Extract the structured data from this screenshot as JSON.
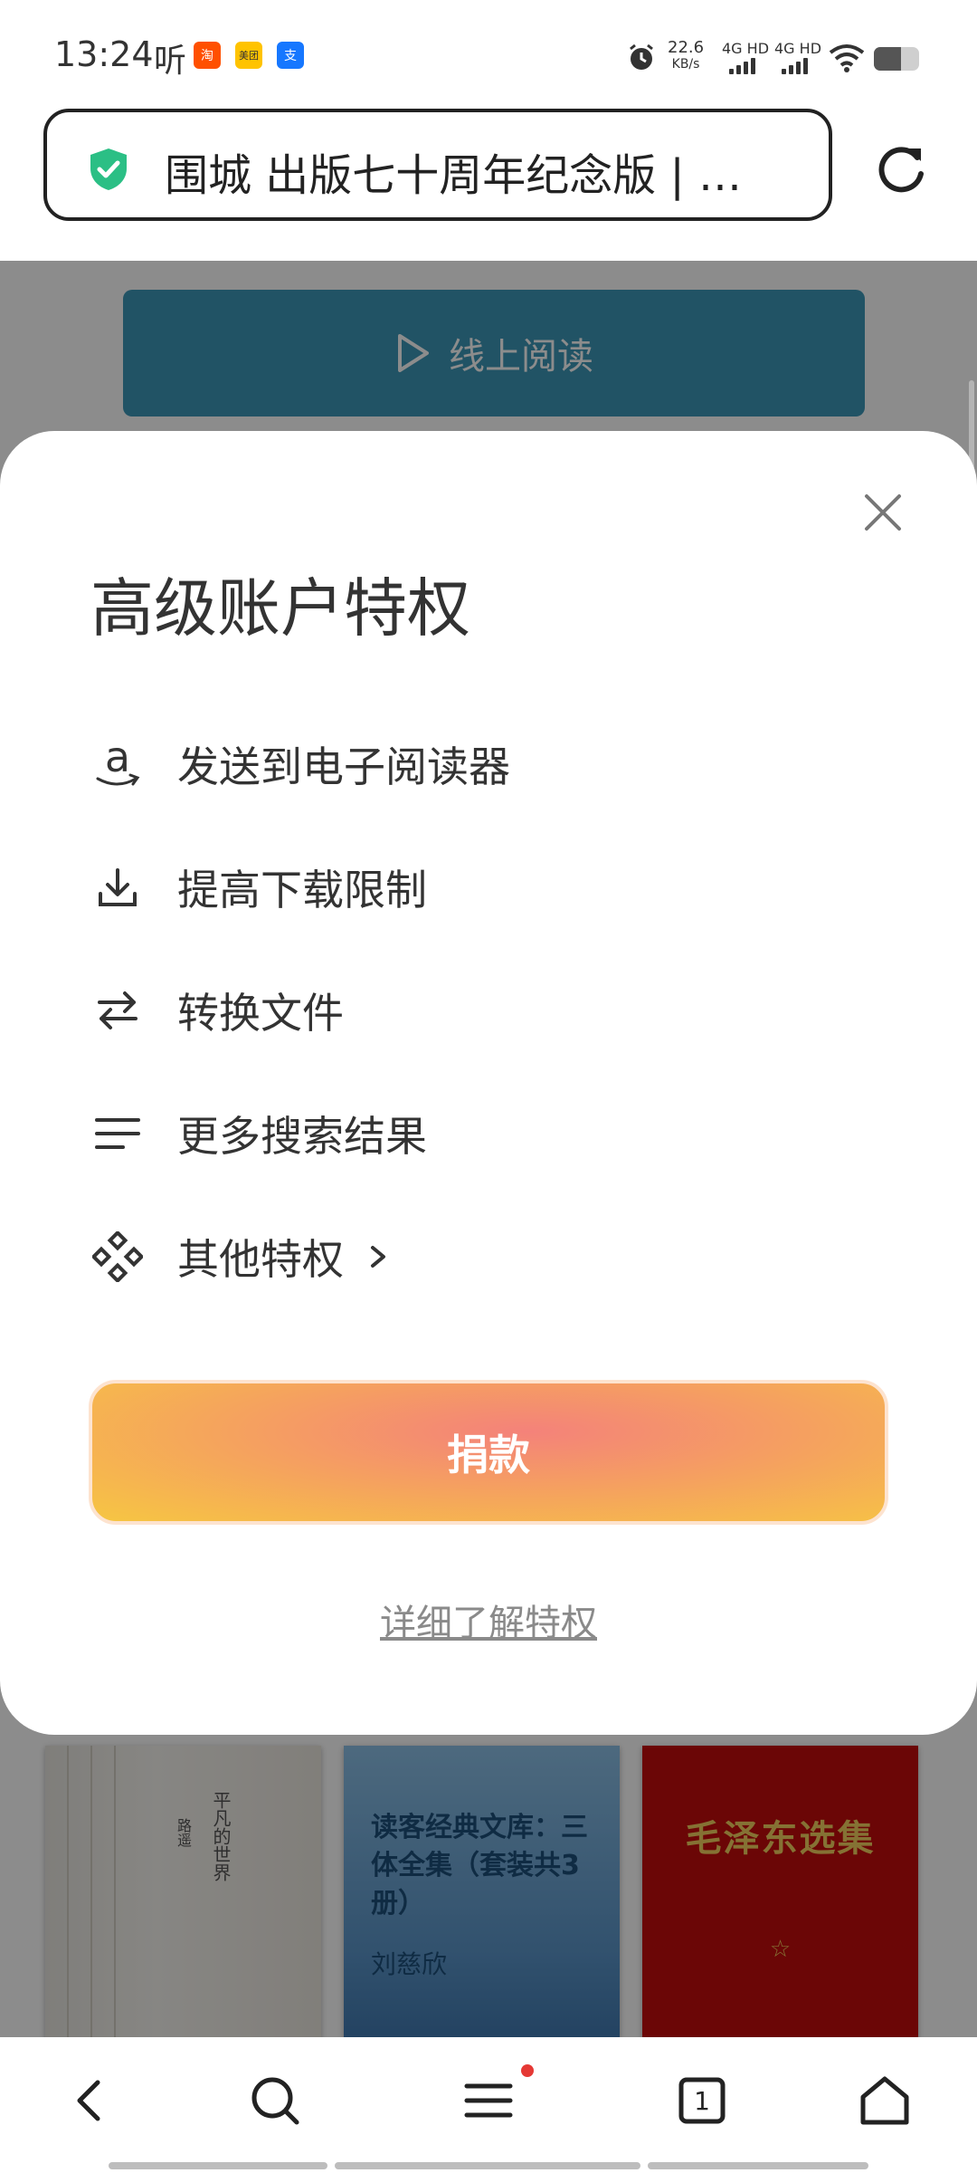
{
  "status_bar": {
    "time": "13:24",
    "ting": "听",
    "apps": [
      {
        "name": "taobao-icon",
        "glyph": "淘",
        "color": "#ff5000"
      },
      {
        "name": "meituan-icon",
        "glyph": "美团",
        "color": "#ffc300"
      },
      {
        "name": "alipay-icon",
        "glyph": "支",
        "color": "#1677ff"
      }
    ],
    "net_speed": "22.6",
    "net_unit": "KB/s",
    "sim1": "4G HD",
    "sim2": "4G HD",
    "battery_level": 0.6
  },
  "browser": {
    "url_title": "围城 出版七十周年纪念版 | …",
    "secure_color": "#2bbf85"
  },
  "page": {
    "read_online": "线上阅读",
    "books": [
      {
        "title": "平凡的世界",
        "author": "路遥"
      },
      {
        "title": "读客经典文库：三体全集（套装共3册）",
        "author": "刘慈欣"
      },
      {
        "title": "毛泽东选集",
        "symbol": "☆"
      }
    ]
  },
  "sheet": {
    "title": "高级账户特权",
    "features": [
      {
        "icon": "amazon-icon",
        "label": "发送到电子阅读器"
      },
      {
        "icon": "download-icon",
        "label": "提高下载限制"
      },
      {
        "icon": "swap-icon",
        "label": "转换文件"
      },
      {
        "icon": "lines-icon",
        "label": "更多搜索结果"
      },
      {
        "icon": "diamond-grid-icon",
        "label": "其他特权"
      }
    ],
    "donate_label": "捐款",
    "learn_more": "详细了解特权"
  },
  "nav": {
    "tab_count": "1"
  }
}
